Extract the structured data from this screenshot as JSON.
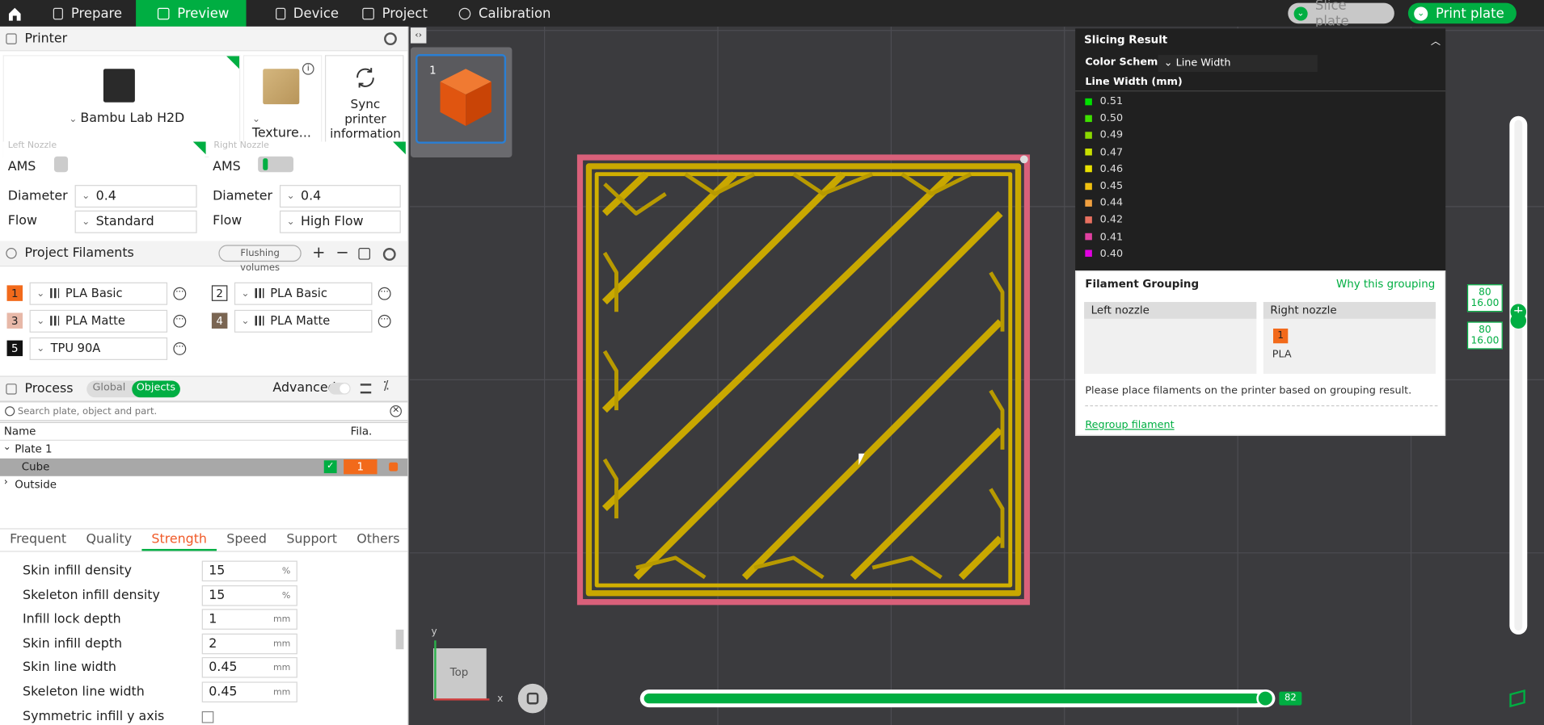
{
  "tabs": [
    {
      "label": "Prepare"
    },
    {
      "label": "Preview"
    },
    {
      "label": "Device"
    },
    {
      "label": "Project"
    },
    {
      "label": "Calibration"
    }
  ],
  "top_actions": {
    "slice": "Slice plate",
    "print": "Print plate"
  },
  "printer": {
    "section_title": "Printer",
    "model": "Bambu Lab H2D",
    "plate": "Texture...",
    "sync_label_1": "Sync printer",
    "sync_label_2": "information",
    "left_nozzle": {
      "title": "Left Nozzle",
      "ams": "AMS",
      "diameter_label": "Diameter",
      "diameter": "0.4",
      "flow_label": "Flow",
      "flow": "Standard"
    },
    "right_nozzle": {
      "title": "Right Nozzle",
      "ams": "AMS",
      "diameter_label": "Diameter",
      "diameter": "0.4",
      "flow_label": "Flow",
      "flow": "High Flow"
    }
  },
  "filaments": {
    "section_title": "Project Filaments",
    "flushing": "Flushing volumes",
    "items": [
      {
        "num": "1",
        "name": "PLA Basic",
        "color": "#f26a1b"
      },
      {
        "num": "2",
        "name": "PLA Basic",
        "color": "#ffffff"
      },
      {
        "num": "3",
        "name": "PLA Matte",
        "color": "#e7b8a8"
      },
      {
        "num": "4",
        "name": "PLA Matte",
        "color": "#7a6552"
      },
      {
        "num": "5",
        "name": "TPU 90A",
        "color": "#111111"
      }
    ]
  },
  "process": {
    "title": "Process",
    "global": "Global",
    "objects": "Objects",
    "advanced": "Advanced"
  },
  "search": {
    "placeholder": "Search plate, object and part."
  },
  "tree": {
    "col_name": "Name",
    "col_fila": "Fila.",
    "plate": "Plate 1",
    "object": "Cube",
    "object_fila": "1",
    "outside": "Outside"
  },
  "param_tabs": [
    "Frequent",
    "Quality",
    "Strength",
    "Speed",
    "Support",
    "Others"
  ],
  "params": [
    {
      "label": "Skin infill density",
      "value": "15",
      "unit": "%"
    },
    {
      "label": "Skeleton infill density",
      "value": "15",
      "unit": "%"
    },
    {
      "label": "Infill lock depth",
      "value": "1",
      "unit": "mm"
    },
    {
      "label": "Skin infill depth",
      "value": "2",
      "unit": "mm"
    },
    {
      "label": "Skin line width",
      "value": "0.45",
      "unit": "mm"
    },
    {
      "label": "Skeleton line width",
      "value": "0.45",
      "unit": "mm"
    },
    {
      "label": "Symmetric infill y axis",
      "value": "",
      "unit": ""
    }
  ],
  "plate_thumb": {
    "number": "1"
  },
  "slicing": {
    "title": "Slicing Result",
    "scheme_label": "Color Scheme",
    "scheme_value": "Line Width",
    "unit_title": "Line Width (mm)",
    "legend": [
      {
        "value": "0.51",
        "color": "#00e000"
      },
      {
        "value": "0.50",
        "color": "#3ee000"
      },
      {
        "value": "0.49",
        "color": "#8ad800"
      },
      {
        "value": "0.47",
        "color": "#c8e000"
      },
      {
        "value": "0.46",
        "color": "#e8e000"
      },
      {
        "value": "0.45",
        "color": "#f0c010"
      },
      {
        "value": "0.44",
        "color": "#f0a040"
      },
      {
        "value": "0.42",
        "color": "#e87060"
      },
      {
        "value": "0.41",
        "color": "#e040a0"
      },
      {
        "value": "0.40",
        "color": "#e000e0"
      }
    ]
  },
  "grouping": {
    "title": "Filament Grouping",
    "why": "Why this grouping",
    "left": "Left nozzle",
    "right": "Right nozzle",
    "chip": "1",
    "chip_material": "PLA",
    "note": "Please place filaments on the printer based on grouping result.",
    "regroup": "Regroup filament"
  },
  "layer_slider": {
    "top_layer": "80",
    "top_height": "16.00",
    "bottom_layer": "80",
    "bottom_height": "16.00"
  },
  "move_slider": {
    "value": "82"
  },
  "view_cube": {
    "label": "Top",
    "x": "x",
    "y": "y"
  }
}
